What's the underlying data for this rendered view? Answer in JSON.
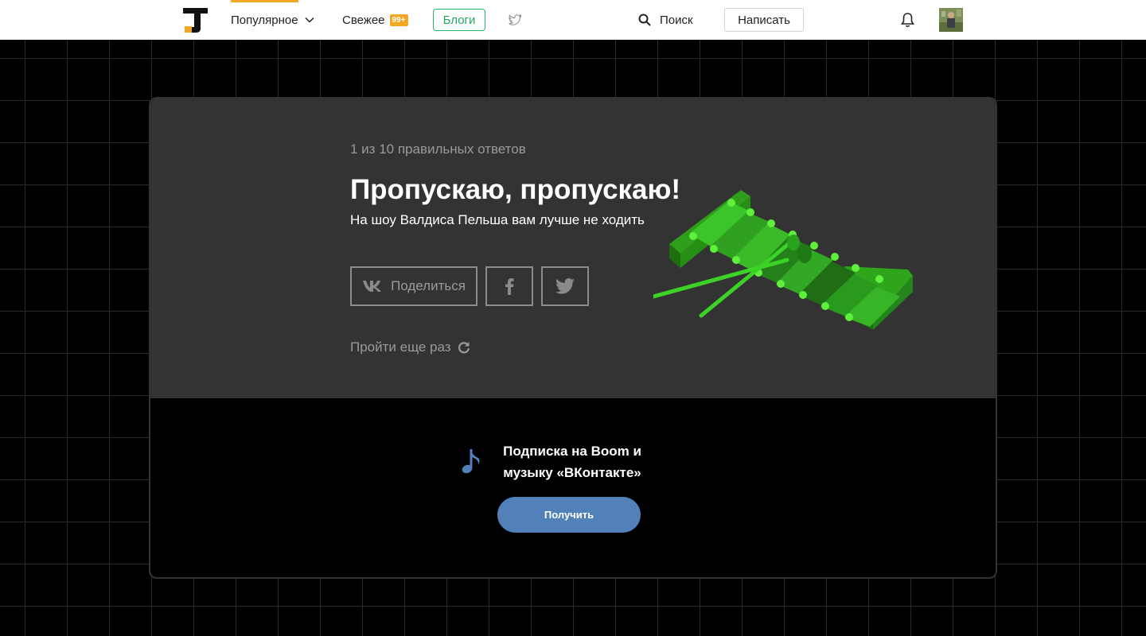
{
  "header": {
    "nav_popular": "Популярное",
    "nav_fresh": "Свежее",
    "fresh_badge": "99+",
    "nav_blogs": "Блоги",
    "search_label": "Поиск",
    "write_button": "Написать",
    "icons": [
      "tj-logo-icon",
      "chevron-down-icon",
      "twitter-icon",
      "search-icon",
      "bell-icon"
    ]
  },
  "quiz_result": {
    "score": "1 из 10 правильных ответов",
    "title": "Пропускаю, пропускаю!",
    "subtitle": "На шоу Валдиса Пельша вам лучше не ходить",
    "share_vk_label": "Поделиться",
    "retry_label": "Пройти еще раз",
    "icons": [
      "vk-icon",
      "facebook-icon",
      "twitter-icon",
      "refresh-icon",
      "xylophone-image"
    ]
  },
  "promo": {
    "text": "Подписка на Boom и музыку «ВКонтакте»",
    "button": "Получить",
    "icon": "music-note-icon",
    "accent_color": "#5181b8"
  },
  "colors": {
    "brand_orange": "#f5a623",
    "blogs_green": "#23a863",
    "card_background": "#333333",
    "page_background": "#000000"
  }
}
